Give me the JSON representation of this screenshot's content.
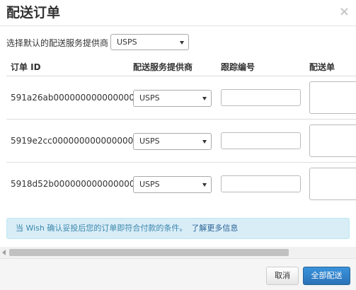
{
  "modal": {
    "title": "配送订单",
    "close_glyph": "×"
  },
  "default_provider": {
    "label": "选择默认的配送服务提供商",
    "value": "USPS"
  },
  "table": {
    "headers": [
      "订单 ID",
      "配送服务提供商",
      "跟踪编号",
      "配送单"
    ],
    "rows": [
      {
        "order_id": "591a26ab0000000000000000",
        "provider": "USPS",
        "tracking": "",
        "delivery_note": ""
      },
      {
        "order_id": "5919e2cc0000000000000000",
        "provider": "USPS",
        "tracking": "",
        "delivery_note": ""
      },
      {
        "order_id": "5918d52b0000000000000000",
        "provider": "USPS",
        "tracking": "",
        "delivery_note": ""
      }
    ]
  },
  "alert": {
    "text": "当 Wish 确认妥投后您的订单即符合付款的条件。",
    "link": "了解更多信息"
  },
  "footer": {
    "cancel_label": "取消",
    "submit_label": "全部配送"
  },
  "colors": {
    "alert_bg": "#d9edf7",
    "alert_text": "#3a87ad",
    "primary_button": "#2b72b8"
  }
}
